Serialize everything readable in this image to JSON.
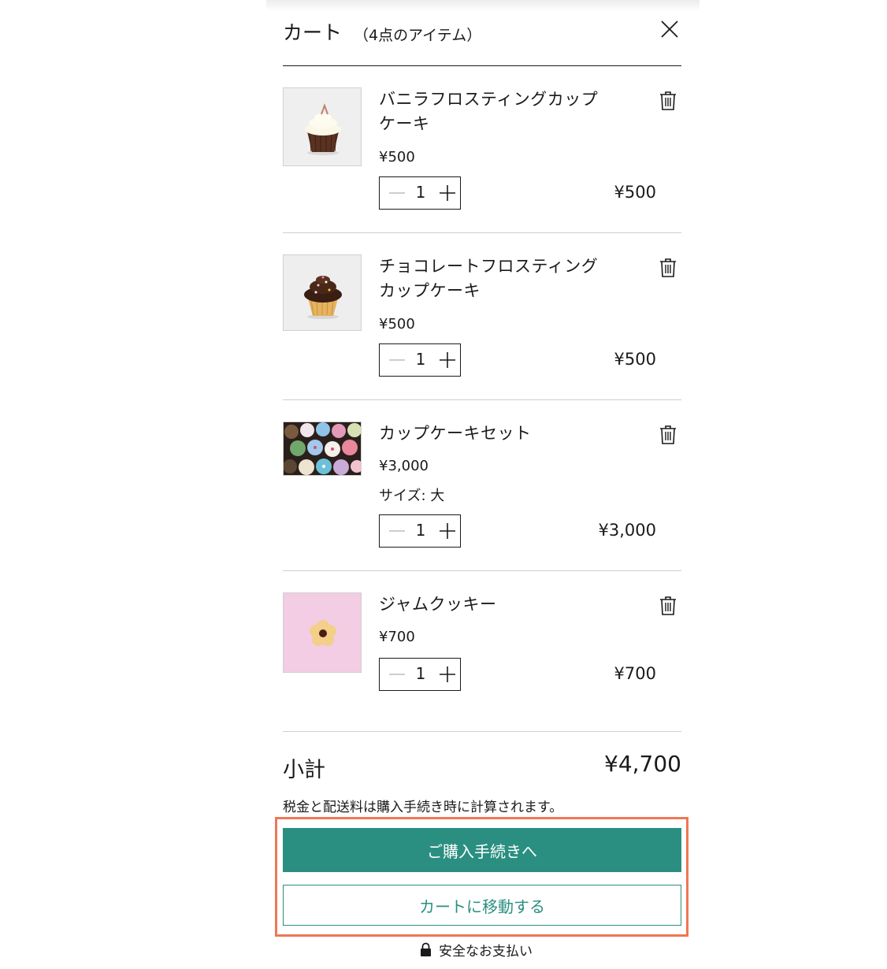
{
  "header": {
    "title": "カート",
    "count": "（4点のアイテム）"
  },
  "items": [
    {
      "name": "バニラフロスティングカップケーキ",
      "unit_price": "¥500",
      "quantity": "1",
      "line_total": "¥500",
      "thumb": "vanilla-cupcake-image"
    },
    {
      "name": "チョコレートフロスティングカップケーキ",
      "unit_price": "¥500",
      "quantity": "1",
      "line_total": "¥500",
      "thumb": "chocolate-cupcake-image"
    },
    {
      "name": "カップケーキセット",
      "unit_price": "¥3,000",
      "option": "サイズ: 大",
      "quantity": "1",
      "line_total": "¥3,000",
      "thumb": "cupcake-set-image"
    },
    {
      "name": "ジャムクッキー",
      "unit_price": "¥700",
      "quantity": "1",
      "line_total": "¥700",
      "thumb": "jam-cookie-image"
    }
  ],
  "summary": {
    "subtotal_label": "小計",
    "subtotal_value": "¥4,700",
    "tax_note": "税金と配送料は購入手続き時に計算されます。"
  },
  "actions": {
    "checkout_label": "ご購入手続きへ",
    "view_cart_label": "カートに移動する",
    "secure_label": "安全なお支払い"
  },
  "colors": {
    "accent": "#2a8f80",
    "highlight": "#ee7755",
    "text": "#1a1a1a"
  },
  "icons": {
    "close": "close-icon",
    "delete": "trash-icon",
    "decrement": "minus-icon",
    "increment": "plus-icon",
    "secure": "lock-icon"
  }
}
